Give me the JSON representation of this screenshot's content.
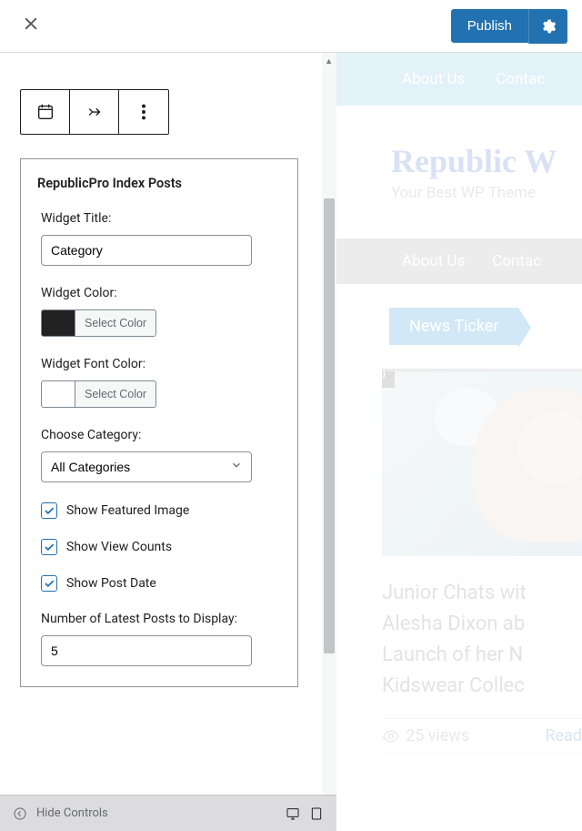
{
  "topbar": {
    "publish_label": "Publish"
  },
  "widget": {
    "title": "RepublicPro Index Posts",
    "field_widget_title_label": "Widget Title:",
    "field_widget_title_value": "Category",
    "field_widget_color_label": "Widget Color:",
    "field_widget_font_color_label": "Widget Font Color:",
    "select_color_label": "Select Color",
    "widget_color_value": "#222222",
    "widget_font_color_value": "#ffffff",
    "choose_category_label": "Choose Category:",
    "choose_category_value": "All Categories",
    "show_featured_image_label": "Show Featured Image",
    "show_featured_image_checked": true,
    "show_view_counts_label": "Show View Counts",
    "show_view_counts_checked": true,
    "show_post_date_label": "Show Post Date",
    "show_post_date_checked": true,
    "num_posts_label": "Number of Latest Posts to Display:",
    "num_posts_value": "5"
  },
  "bottombar": {
    "hide_controls_label": "Hide Controls"
  },
  "preview": {
    "nav1": {
      "about": "About Us",
      "contact": "Contac"
    },
    "site_title": "Republic W",
    "site_tagline": "Your Best WP Theme",
    "nav2": {
      "about": "About Us",
      "contact": "Contac"
    },
    "ticker_label": "News Ticker",
    "post": {
      "badge": "0",
      "title": "Junior Chats wit Alesha Dixon ab Launch of her N Kidswear Collec",
      "views": "25 views",
      "readmore": "Read"
    }
  }
}
